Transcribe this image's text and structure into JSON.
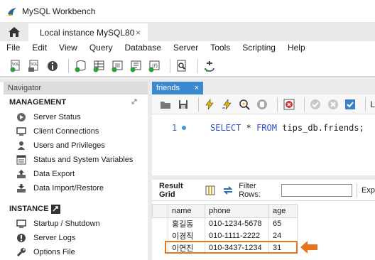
{
  "window": {
    "title": "MySQL Workbench"
  },
  "tabs": {
    "connection": "Local instance MySQL80",
    "close": "×"
  },
  "menu": [
    "File",
    "Edit",
    "View",
    "Query",
    "Database",
    "Server",
    "Tools",
    "Scripting",
    "Help"
  ],
  "navigator": {
    "header": "Navigator",
    "management": {
      "title": "MANAGEMENT",
      "items": [
        "Server Status",
        "Client Connections",
        "Users and Privileges",
        "Status and System Variables",
        "Data Export",
        "Data Import/Restore"
      ]
    },
    "instance": {
      "title": "INSTANCE",
      "items": [
        "Startup / Shutdown",
        "Server Logs",
        "Options File"
      ]
    }
  },
  "query": {
    "tab": "friends",
    "tab_close": "×",
    "line_number": "1",
    "sql_kw1": "SELECT",
    "sql_star": "*",
    "sql_kw2": "FROM",
    "sql_table": "tips_db.friends;",
    "limit_label": "L"
  },
  "results": {
    "label": "Result Grid",
    "filter_label": "Filter Rows:",
    "export_label": "Exp",
    "columns": [
      "name",
      "phone",
      "age"
    ],
    "rows": [
      [
        "홍길동",
        "010-1234-5678",
        "65"
      ],
      [
        "이경직",
        "010-1111-2222",
        "24"
      ],
      [
        "이연진",
        "010-3437-1234",
        "31"
      ]
    ]
  },
  "colors": {
    "tab_active": "#3b8ad0",
    "highlight": "#e8741c",
    "sql_keyword": "#2d4ccf"
  }
}
